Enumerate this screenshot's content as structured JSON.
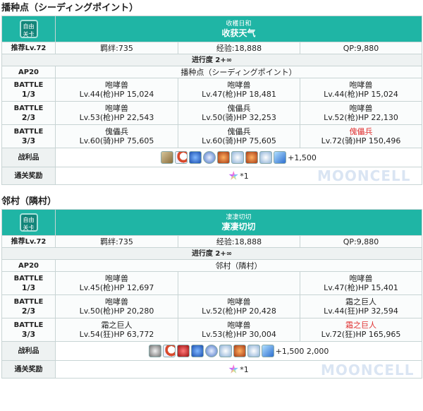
{
  "sections": [
    {
      "title": "播种点（シーディングポイント）",
      "badge": "自由\n关卡",
      "quest_sub": "收穫日和",
      "quest_name": "收获天气",
      "recommend": "推荐Lv.72",
      "bond": "羁绊:735",
      "exp": "经验:18,888",
      "qp": "QP:9,880",
      "progress": "进行度 2+∞",
      "ap": "AP20",
      "location": "播种点（シーディングポイント）",
      "battles": [
        {
          "label1": "BATTLE",
          "label2": "1/3",
          "enemies": [
            {
              "name": "咆哮兽",
              "stats": "Lv.44(枪)HP 15,024",
              "red": false
            },
            {
              "name": "咆哮兽",
              "stats": "Lv.47(枪)HP 18,481",
              "red": false
            },
            {
              "name": "咆哮兽",
              "stats": "Lv.44(枪)HP 15,024",
              "red": false
            }
          ]
        },
        {
          "label1": "BATTLE",
          "label2": "2/3",
          "enemies": [
            {
              "name": "咆哮兽",
              "stats": "Lv.53(枪)HP 22,543",
              "red": false
            },
            {
              "name": "傀儡兵",
              "stats": "Lv.50(骑)HP 32,253",
              "red": false
            },
            {
              "name": "咆哮兽",
              "stats": "Lv.52(枪)HP 22,130",
              "red": false
            }
          ]
        },
        {
          "label1": "BATTLE",
          "label2": "3/3",
          "enemies": [
            {
              "name": "傀儡兵",
              "stats": "Lv.60(骑)HP 75,605",
              "red": false
            },
            {
              "name": "傀儡兵",
              "stats": "Lv.60(骑)HP 75,605",
              "red": false
            },
            {
              "name": "傀儡兵",
              "stats": "Lv.72(骑)HP 150,496",
              "red": true
            }
          ]
        }
      ],
      "drops_label": "战利品",
      "drops": [
        "tan",
        "crescent",
        "blue",
        "orb",
        "fire",
        "ice",
        "fire",
        "ice",
        "crystal"
      ],
      "drops_text": "+1,500",
      "reward_label": "通关奖励",
      "reward_text": "*1"
    },
    {
      "title": "邻村（隣村）",
      "badge": "自由\n关卡",
      "quest_sub": "凄凄切切",
      "quest_name": "凄凄切切",
      "recommend": "推荐Lv.72",
      "bond": "羁绊:735",
      "exp": "经验:18,888",
      "qp": "QP:9,880",
      "progress": "进行度 2+∞",
      "ap": "AP20",
      "location": "邻村（隣村）",
      "battles": [
        {
          "label1": "BATTLE",
          "label2": "1/3",
          "enemies": [
            {
              "name": "咆哮兽",
              "stats": "Lv.45(枪)HP 12,697",
              "red": false
            },
            {
              "name": "",
              "stats": "",
              "red": false
            },
            {
              "name": "咆哮兽",
              "stats": "Lv.47(枪)HP 15,401",
              "red": false
            }
          ]
        },
        {
          "label1": "BATTLE",
          "label2": "2/3",
          "enemies": [
            {
              "name": "咆哮兽",
              "stats": "Lv.50(枪)HP 20,280",
              "red": false
            },
            {
              "name": "咆哮兽",
              "stats": "Lv.52(枪)HP 20,428",
              "red": false
            },
            {
              "name": "霜之巨人",
              "stats": "Lv.44(狂)HP 32,594",
              "red": false
            }
          ]
        },
        {
          "label1": "BATTLE",
          "label2": "3/3",
          "enemies": [
            {
              "name": "霜之巨人",
              "stats": "Lv.54(狂)HP 63,772",
              "red": false
            },
            {
              "name": "咆哮兽",
              "stats": "Lv.53(枪)HP 30,004",
              "red": false
            },
            {
              "name": "霜之巨人",
              "stats": "Lv.72(狂)HP 165,965",
              "red": true
            }
          ]
        }
      ],
      "drops_label": "战利品",
      "drops": [
        "silver",
        "crescent",
        "red",
        "blue",
        "orb",
        "ice",
        "fire",
        "ice",
        "crystal"
      ],
      "drops_text": "+1,500 2,000",
      "reward_label": "通关奖励",
      "reward_text": "*1"
    }
  ],
  "watermark": "MOONCELL"
}
